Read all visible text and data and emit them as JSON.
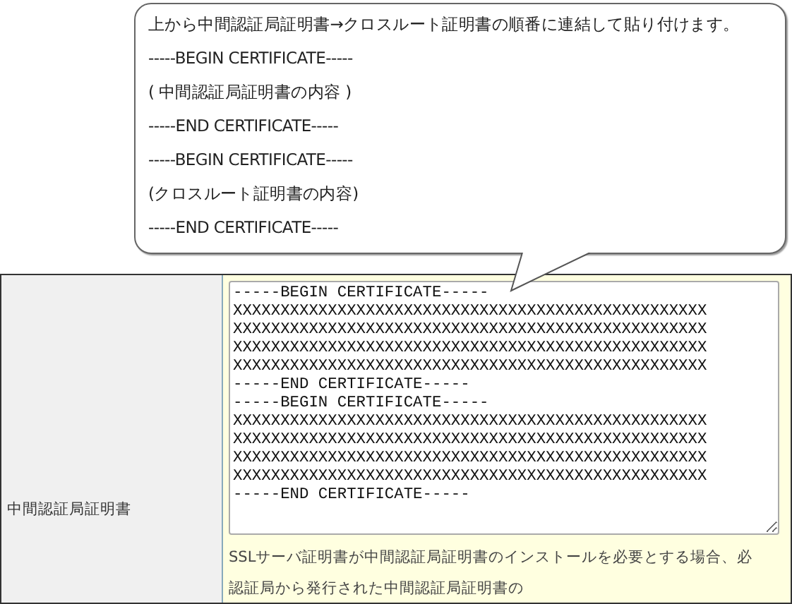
{
  "callout": {
    "lines": [
      "上から中間認証局証明書→クロスルート証明書の順番に連結して貼り付けます。",
      "-----BEGIN CERTIFICATE-----",
      "( 中間認証局証明書の内容 )",
      "-----END CERTIFICATE-----",
      "-----BEGIN CERTIFICATE-----",
      "(クロスルート証明書の内容)",
      "-----END CERTIFICATE-----"
    ]
  },
  "form": {
    "label": "中間認証局証明書",
    "textarea_value": "-----BEGIN CERTIFICATE-----\nXXXXXXXXXXXXXXXXXXXXXXXXXXXXXXXXXXXXXXXXXXXXXXXXXX\nXXXXXXXXXXXXXXXXXXXXXXXXXXXXXXXXXXXXXXXXXXXXXXXXXX\nXXXXXXXXXXXXXXXXXXXXXXXXXXXXXXXXXXXXXXXXXXXXXXXXXX\nXXXXXXXXXXXXXXXXXXXXXXXXXXXXXXXXXXXXXXXXXXXXXXXXXX\n-----END CERTIFICATE-----\n-----BEGIN CERTIFICATE-----\nXXXXXXXXXXXXXXXXXXXXXXXXXXXXXXXXXXXXXXXXXXXXXXXXXX\nXXXXXXXXXXXXXXXXXXXXXXXXXXXXXXXXXXXXXXXXXXXXXXXXXX\nXXXXXXXXXXXXXXXXXXXXXXXXXXXXXXXXXXXXXXXXXXXXXXXXXX\nXXXXXXXXXXXXXXXXXXXXXXXXXXXXXXXXXXXXXXXXXXXXXXXXXX\n-----END CERTIFICATE-----",
    "help_lines": [
      "SSLサーバ証明書が中間認証局証明書のインストールを必要とする場合、必",
      "認証局から発行された中間認証局証明書の"
    ]
  }
}
